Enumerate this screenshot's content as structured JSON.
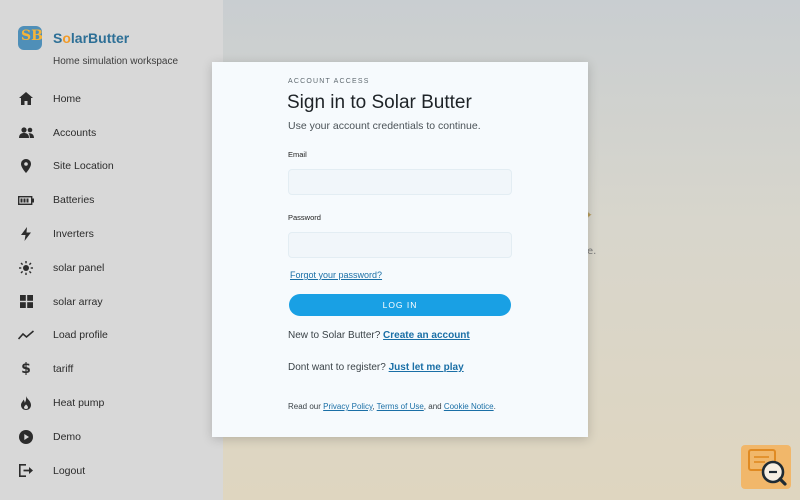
{
  "brand": {
    "name_first": "S",
    "name_accent": "o",
    "name_rest": "larButter",
    "logo_text": "SB",
    "subtitle": "Home simulation workspace"
  },
  "sidebar": {
    "items": [
      {
        "label": "Home",
        "icon": "home-icon"
      },
      {
        "label": "Accounts",
        "icon": "accounts-icon"
      },
      {
        "label": "Site Location",
        "icon": "location-pin-icon"
      },
      {
        "label": "Batteries",
        "icon": "battery-icon"
      },
      {
        "label": "Inverters",
        "icon": "lightning-icon"
      },
      {
        "label": "solar panel",
        "icon": "sun-icon"
      },
      {
        "label": "solar array",
        "icon": "grid-icon"
      },
      {
        "label": "Load profile",
        "icon": "trend-icon"
      },
      {
        "label": "tariff",
        "icon": "dollar-icon"
      },
      {
        "label": "Heat pump",
        "icon": "flame-icon"
      },
      {
        "label": "Demo",
        "icon": "play-icon"
      },
      {
        "label": "Logout",
        "icon": "logout-icon"
      }
    ]
  },
  "background": {
    "fragment": "e."
  },
  "modal": {
    "eyebrow": "ACCOUNT ACCESS",
    "title": "Sign in to Solar Butter",
    "lead": "Use your account credentials to continue.",
    "email_label": "Email",
    "email_value": "",
    "password_label": "Password",
    "password_value": "",
    "forgot_link": "Forgot your password?",
    "login_button": "LOG IN",
    "new_prefix": "New to Solar Butter?",
    "create_link": "Create an account",
    "dont_prefix": "Dont want to register?",
    "play_link": "Just let me play",
    "legal_prefix": "Read our",
    "privacy_link": "Privacy Policy",
    "legal_comma": ",",
    "terms_link": "Terms of Use",
    "legal_and": ", and",
    "cookie_link": "Cookie Notice",
    "legal_end": "."
  },
  "colors": {
    "accent": "#19a0e4",
    "brand_blue": "#2d6f96",
    "brand_orange": "#f09a28",
    "link": "#1a6fa6"
  },
  "fab": {
    "icon": "search-help-icon"
  }
}
